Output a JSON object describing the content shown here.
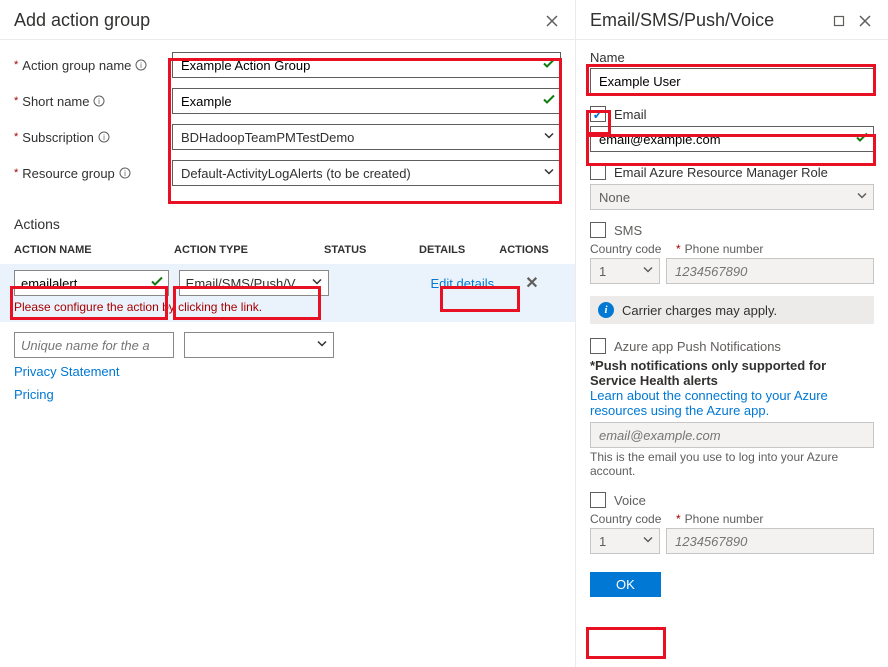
{
  "leftPane": {
    "title": "Add action group",
    "fields": {
      "actionGroupName": {
        "label": "Action group name",
        "value": "Example Action Group"
      },
      "shortName": {
        "label": "Short name",
        "value": "Example"
      },
      "subscription": {
        "label": "Subscription",
        "value": "BDHadoopTeamPMTestDemo"
      },
      "resourceGroup": {
        "label": "Resource group",
        "value": "Default-ActivityLogAlerts (to be created)"
      }
    },
    "actionsSection": {
      "title": "Actions",
      "columns": {
        "name": "ACTION NAME",
        "type": "ACTION TYPE",
        "status": "STATUS",
        "details": "DETAILS",
        "actions": "ACTIONS"
      },
      "row1": {
        "name": "emailalert",
        "type": "Email/SMS/Push/V...",
        "detailsLink": "Edit details"
      },
      "errorMsg": "Please configure the action by clicking the link.",
      "row2Placeholder": "Unique name for the act..."
    },
    "links": {
      "privacy": "Privacy Statement",
      "pricing": "Pricing"
    }
  },
  "rightPane": {
    "title": "Email/SMS/Push/Voice",
    "nameLabel": "Name",
    "nameValue": "Example User",
    "emailLabel": "Email",
    "emailValue": "email@example.com",
    "armRoleLabel": "Email Azure Resource Manager Role",
    "armRoleSelect": "None",
    "smsLabel": "SMS",
    "countryCodeLabel": "Country code",
    "phoneNumberLabel": "Phone number",
    "countryCodeValue": "1",
    "phonePlaceholder": "1234567890",
    "carrierMsg": "Carrier charges may apply.",
    "pushLabel": "Azure app Push Notifications",
    "pushNote": "*Push notifications only supported for Service Health alerts",
    "pushLink": "Learn about the connecting to your Azure resources using the Azure app.",
    "pushEmailPlaceholder": "email@example.com",
    "pushHelp": "This is the email you use to log into your Azure account.",
    "voiceLabel": "Voice",
    "okLabel": "OK"
  }
}
